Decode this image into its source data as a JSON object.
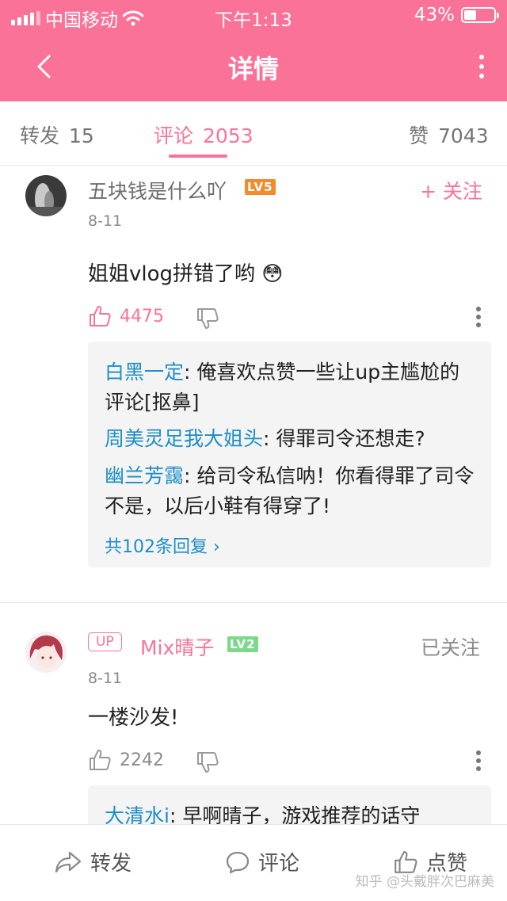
{
  "status": {
    "carrier": "中国移动",
    "time": "下午1:13",
    "battery": "43%",
    "battery_level": 0.43
  },
  "header": {
    "title": "详情"
  },
  "tabs": [
    {
      "label": "转发",
      "count": "15"
    },
    {
      "label": "评论",
      "count": "2053"
    },
    {
      "label": "赞",
      "count": "7043"
    }
  ],
  "comments": [
    {
      "user": "五块钱是什么吖",
      "level": "LV5",
      "follow": "+ 关注",
      "date": "8-11",
      "text": "姐姐vlog拼错了哟",
      "emoji": "😳",
      "likes": "4475",
      "replies": [
        {
          "name": "白黑一定",
          "text": ": 俺喜欢点赞一些让up主尴尬的评论[抠鼻]"
        },
        {
          "name": "周美灵足我大姐头",
          "text": ": 得罪司令还想走?"
        },
        {
          "name": "幽兰芳靄",
          "text": ": 给司令私信呐！你看得罪了司令不是，以后小鞋有得穿了!"
        }
      ],
      "more": "共102条回复 ›"
    },
    {
      "up_badge": "UP",
      "user": "Mix晴子",
      "level": "LV2",
      "follow": "已关注",
      "date": "8-11",
      "text": "一楼沙发!",
      "likes": "2242",
      "replies": [
        {
          "name": "大清水i",
          "text": ": 早啊晴子，游戏推荐的话守"
        }
      ]
    }
  ],
  "bottom": {
    "repost": "转发",
    "comment": "评论",
    "like": "点赞"
  },
  "watermark": "知乎 @头戴胖次巴麻美",
  "colors": {
    "accent": "#fb7299",
    "link": "#1d8ec7",
    "lv5": "#f28b2e",
    "lv2": "#7bd98b"
  }
}
